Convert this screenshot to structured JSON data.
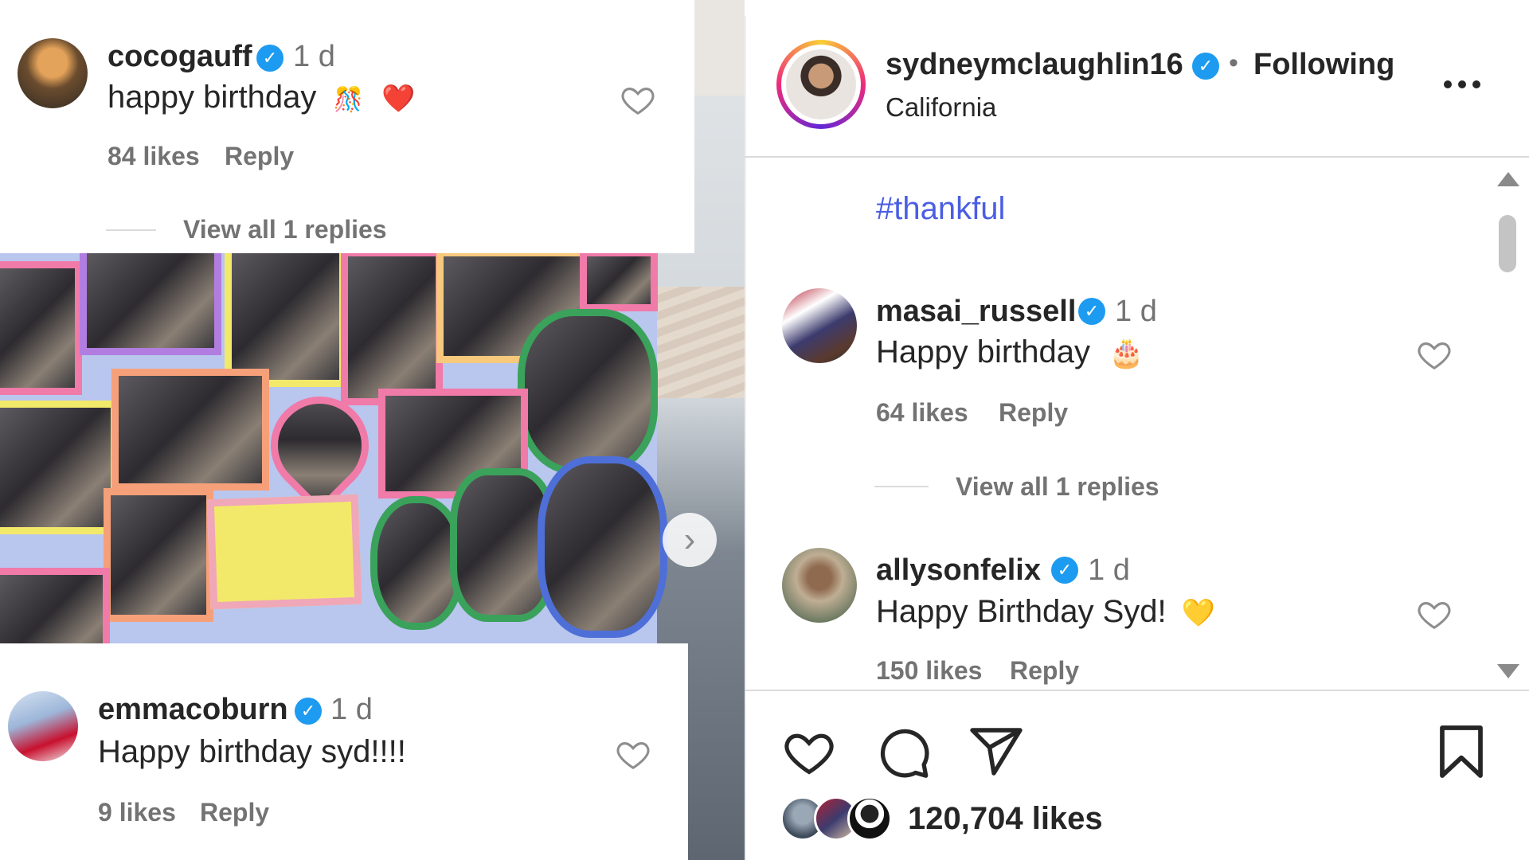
{
  "left_comments": [
    {
      "username": "cocogauff",
      "verified": true,
      "time": "1 d",
      "text": "happy birthday",
      "emojis": [
        "🎊",
        "❤️"
      ],
      "likes": "84 likes",
      "reply": "Reply",
      "replies": "View all 1 replies"
    },
    {
      "username": "emmacoburn",
      "verified": true,
      "time": "1 d",
      "text": "Happy birthday syd!!!!",
      "likes": "9 likes",
      "reply": "Reply"
    }
  ],
  "post_header": {
    "username": "sydneymclaughlin16",
    "verified": true,
    "separator": "•",
    "follow_status": "Following",
    "location": "California",
    "more_icon": "more-horizontal-icon"
  },
  "caption": {
    "hashtag": "#thankful"
  },
  "right_comments": [
    {
      "username": "masai_russell",
      "verified": true,
      "time": "1 d",
      "text": "Happy birthday",
      "emoji": "🎂",
      "likes": "64 likes",
      "reply": "Reply",
      "replies": "View all 1 replies"
    },
    {
      "username": "allysonfelix",
      "verified": true,
      "time": "1 d",
      "text": "Happy Birthday Syd!",
      "emoji": "💛",
      "likes": "150 likes",
      "reply": "Reply"
    }
  ],
  "actions": {
    "icons": [
      "heart-icon",
      "comment-icon",
      "share-icon",
      "bookmark-icon"
    ]
  },
  "stats": {
    "likes": "120,704 likes"
  },
  "colors": {
    "verified": "#1d9bf0",
    "hashtag": "#4b5ee3",
    "secondary_text": "#737373"
  }
}
